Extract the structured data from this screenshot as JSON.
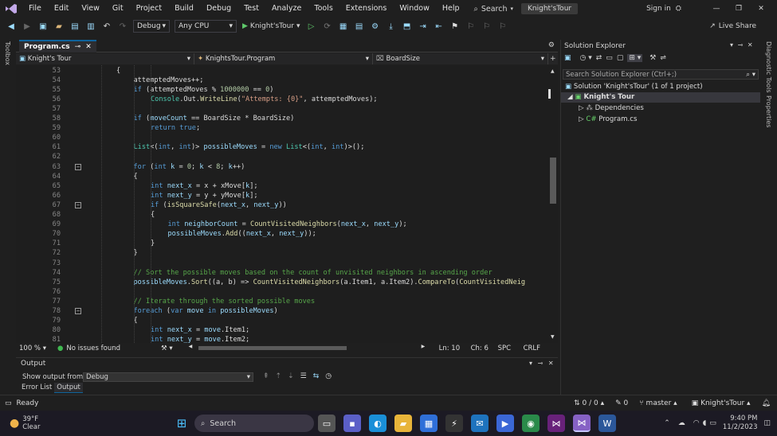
{
  "menu": {
    "items": [
      "File",
      "Edit",
      "View",
      "Git",
      "Project",
      "Build",
      "Debug",
      "Test",
      "Analyze",
      "Tools",
      "Extensions",
      "Window",
      "Help"
    ],
    "search_label": "Search",
    "solution_name": "Knight'sTour",
    "sign_in": "Sign in"
  },
  "toolbar": {
    "config": "Debug",
    "platform": "Any CPU",
    "start_target": "Knight'sTour",
    "live_share": "Live Share"
  },
  "side": {
    "left": "Toolbox",
    "right_top": "Diagnostic Tools",
    "right_bottom": "Properties"
  },
  "editor": {
    "tab": "Program.cs",
    "nav_project": "Knight's Tour",
    "nav_class": "KnightsTour.Program",
    "nav_member": "BoardSize",
    "lines": [
      {
        "n": "53",
        "indent": 0,
        "tokens": [
          [
            "{",
            "p"
          ]
        ]
      },
      {
        "n": "54",
        "indent": 1,
        "tokens": [
          [
            "attemptedMoves++;",
            "p"
          ]
        ]
      },
      {
        "n": "55",
        "indent": 1,
        "tokens": [
          [
            "if",
            "kw"
          ],
          [
            " (attemptedMoves % ",
            "p"
          ],
          [
            "1000000",
            "nm"
          ],
          [
            " == ",
            "p"
          ],
          [
            "0",
            "nm"
          ],
          [
            ")",
            "p"
          ]
        ]
      },
      {
        "n": "56",
        "indent": 2,
        "tokens": [
          [
            "Console",
            "ty"
          ],
          [
            ".Out.",
            "p"
          ],
          [
            "WriteLine",
            "fn"
          ],
          [
            "(",
            "p"
          ],
          [
            "\"Attempts: {0}\"",
            "st"
          ],
          [
            ", attemptedMoves);",
            "p"
          ]
        ]
      },
      {
        "n": "57",
        "indent": 0,
        "tokens": []
      },
      {
        "n": "58",
        "indent": 1,
        "tokens": [
          [
            "if",
            "kw"
          ],
          [
            " (",
            "p"
          ],
          [
            "moveCount",
            "vr"
          ],
          [
            " == BoardSize * BoardSize)",
            "p"
          ]
        ]
      },
      {
        "n": "59",
        "indent": 2,
        "tokens": [
          [
            "return",
            "kw"
          ],
          [
            " ",
            "p"
          ],
          [
            "true",
            "kw"
          ],
          [
            ";",
            "p"
          ]
        ]
      },
      {
        "n": "60",
        "indent": 0,
        "tokens": []
      },
      {
        "n": "61",
        "indent": 1,
        "tokens": [
          [
            "List",
            "ty"
          ],
          [
            "<(",
            "p"
          ],
          [
            "int",
            "kw"
          ],
          [
            ", ",
            "p"
          ],
          [
            "int",
            "kw"
          ],
          [
            ")> ",
            "p"
          ],
          [
            "possibleMoves",
            "vr"
          ],
          [
            " = ",
            "p"
          ],
          [
            "new",
            "kw"
          ],
          [
            " ",
            "p"
          ],
          [
            "List",
            "ty"
          ],
          [
            "<(",
            "p"
          ],
          [
            "int",
            "kw"
          ],
          [
            ", ",
            "p"
          ],
          [
            "int",
            "kw"
          ],
          [
            ")>();",
            "p"
          ]
        ]
      },
      {
        "n": "62",
        "indent": 0,
        "tokens": []
      },
      {
        "n": "63",
        "indent": 1,
        "fold": true,
        "tokens": [
          [
            "for",
            "kw"
          ],
          [
            " (",
            "p"
          ],
          [
            "int",
            "kw"
          ],
          [
            " ",
            "p"
          ],
          [
            "k",
            "vr"
          ],
          [
            " = ",
            "p"
          ],
          [
            "0",
            "nm"
          ],
          [
            "; ",
            "p"
          ],
          [
            "k",
            "vr"
          ],
          [
            " < ",
            "p"
          ],
          [
            "8",
            "nm"
          ],
          [
            "; ",
            "p"
          ],
          [
            "k",
            "vr"
          ],
          [
            "++)",
            "p"
          ]
        ]
      },
      {
        "n": "64",
        "indent": 1,
        "tokens": [
          [
            "{",
            "p"
          ]
        ]
      },
      {
        "n": "65",
        "indent": 2,
        "tokens": [
          [
            "int",
            "kw"
          ],
          [
            " ",
            "p"
          ],
          [
            "next_x",
            "vr"
          ],
          [
            " = x + xMove[",
            "p"
          ],
          [
            "k",
            "vr"
          ],
          [
            "];",
            "p"
          ]
        ]
      },
      {
        "n": "66",
        "indent": 2,
        "tokens": [
          [
            "int",
            "kw"
          ],
          [
            " ",
            "p"
          ],
          [
            "next_y",
            "vr"
          ],
          [
            " = y + yMove[",
            "p"
          ],
          [
            "k",
            "vr"
          ],
          [
            "];",
            "p"
          ]
        ]
      },
      {
        "n": "67",
        "indent": 2,
        "fold": true,
        "tokens": [
          [
            "if",
            "kw"
          ],
          [
            " (",
            "p"
          ],
          [
            "isSquareSafe",
            "fn"
          ],
          [
            "(",
            "p"
          ],
          [
            "next_x",
            "vr"
          ],
          [
            ", ",
            "p"
          ],
          [
            "next_y",
            "vr"
          ],
          [
            "))",
            "p"
          ]
        ]
      },
      {
        "n": "68",
        "indent": 2,
        "tokens": [
          [
            "{",
            "p"
          ]
        ]
      },
      {
        "n": "69",
        "indent": 3,
        "tokens": [
          [
            "int",
            "kw"
          ],
          [
            " ",
            "p"
          ],
          [
            "neighborCount",
            "vr"
          ],
          [
            " = ",
            "p"
          ],
          [
            "CountVisitedNeighbors",
            "fn"
          ],
          [
            "(",
            "p"
          ],
          [
            "next_x",
            "vr"
          ],
          [
            ", ",
            "p"
          ],
          [
            "next_y",
            "vr"
          ],
          [
            ");",
            "p"
          ]
        ]
      },
      {
        "n": "70",
        "indent": 3,
        "tokens": [
          [
            "possibleMoves",
            "vr"
          ],
          [
            ".",
            "p"
          ],
          [
            "Add",
            "fn"
          ],
          [
            "((",
            "p"
          ],
          [
            "next_x",
            "vr"
          ],
          [
            ", ",
            "p"
          ],
          [
            "next_y",
            "vr"
          ],
          [
            "));",
            "p"
          ]
        ]
      },
      {
        "n": "71",
        "indent": 2,
        "tokens": [
          [
            "}",
            "p"
          ]
        ]
      },
      {
        "n": "72",
        "indent": 1,
        "tokens": [
          [
            "}",
            "p"
          ]
        ]
      },
      {
        "n": "73",
        "indent": 0,
        "tokens": []
      },
      {
        "n": "74",
        "indent": 1,
        "tokens": [
          [
            "// Sort the possible moves based on the count of unvisited neighbors in ascending order",
            "cm"
          ]
        ]
      },
      {
        "n": "75",
        "indent": 1,
        "tokens": [
          [
            "possibleMoves",
            "vr"
          ],
          [
            ".",
            "p"
          ],
          [
            "Sort",
            "fn"
          ],
          [
            "((a, b) => ",
            "p"
          ],
          [
            "CountVisitedNeighbors",
            "fn"
          ],
          [
            "(a.Item1, a.Item2).",
            "p"
          ],
          [
            "CompareTo",
            "fn"
          ],
          [
            "(",
            "p"
          ],
          [
            "CountVisitedNeig",
            "fn"
          ]
        ]
      },
      {
        "n": "76",
        "indent": 0,
        "tokens": []
      },
      {
        "n": "77",
        "indent": 1,
        "tokens": [
          [
            "// Iterate through the sorted possible moves",
            "cm"
          ]
        ]
      },
      {
        "n": "78",
        "indent": 1,
        "fold": true,
        "tokens": [
          [
            "foreach",
            "kw"
          ],
          [
            " (",
            "p"
          ],
          [
            "var",
            "kw"
          ],
          [
            " ",
            "p"
          ],
          [
            "move",
            "vr"
          ],
          [
            " ",
            "p"
          ],
          [
            "in",
            "kw"
          ],
          [
            " ",
            "p"
          ],
          [
            "possibleMoves",
            "vr"
          ],
          [
            ")",
            "p"
          ]
        ]
      },
      {
        "n": "79",
        "indent": 1,
        "tokens": [
          [
            "{",
            "p"
          ]
        ]
      },
      {
        "n": "80",
        "indent": 2,
        "tokens": [
          [
            "int",
            "kw"
          ],
          [
            " ",
            "p"
          ],
          [
            "next_x",
            "vr"
          ],
          [
            " = ",
            "p"
          ],
          [
            "move",
            "vr"
          ],
          [
            ".Item1;",
            "p"
          ]
        ]
      },
      {
        "n": "81",
        "indent": 2,
        "tokens": [
          [
            "int",
            "kw"
          ],
          [
            " ",
            "p"
          ],
          [
            "next_y",
            "vr"
          ],
          [
            " = ",
            "p"
          ],
          [
            "move",
            "vr"
          ],
          [
            ".Item2;",
            "p"
          ]
        ]
      }
    ],
    "zoom": "100 %",
    "issues": "No issues found",
    "ln": "Ln: 10",
    "ch": "Ch: 6",
    "enc": "SPC",
    "eol": "CRLF"
  },
  "output": {
    "title": "Output",
    "show_from_label": "Show output from:",
    "source": "Debug",
    "tabs": [
      "Error List",
      "Output"
    ]
  },
  "solution_explorer": {
    "title": "Solution Explorer",
    "search_placeholder": "Search Solution Explorer (Ctrl+;)",
    "solution": "Solution 'Knight'sTour' (1 of 1 project)",
    "project": "Knight's Tour",
    "dependencies": "Dependencies",
    "file": "Program.cs"
  },
  "statusbar": {
    "ready": "Ready",
    "changes": "0 / 0",
    "edits": "0",
    "branch": "master",
    "repo": "Knight'sTour"
  },
  "taskbar": {
    "weather_temp": "39°F",
    "weather_desc": "Clear",
    "search": "Search",
    "time": "9:40 PM",
    "date": "11/2/2023"
  },
  "colors": {
    "accent": "#0e639c",
    "vs_purple": "#68217a",
    "selected": "#37373d"
  }
}
